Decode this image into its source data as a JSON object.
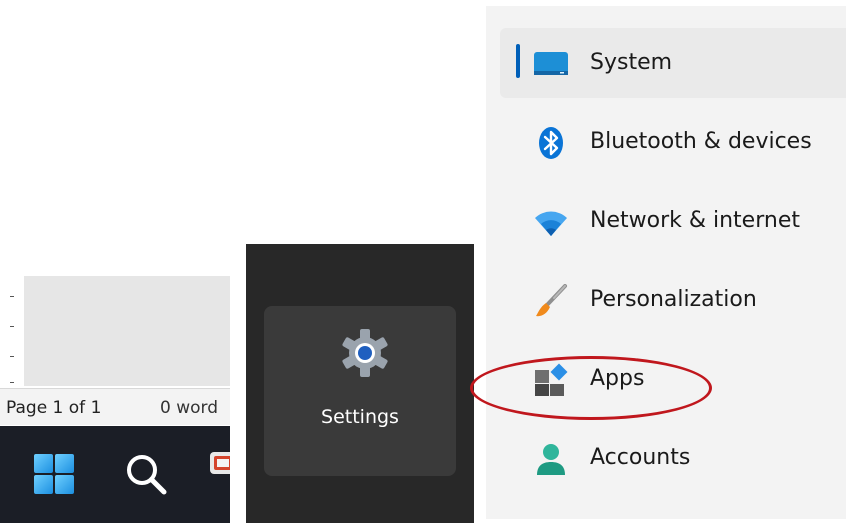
{
  "word": {
    "status_page": "Page 1 of 1",
    "status_words": "0 word"
  },
  "taskbar": {
    "icons": [
      "windows-start-icon",
      "search-icon",
      "app-icon"
    ]
  },
  "start_menu": {
    "settings_label": "Settings",
    "settings_icon": "gear-icon"
  },
  "settings_nav": {
    "items": [
      {
        "label": "System",
        "icon": "display-icon",
        "selected": true
      },
      {
        "label": "Bluetooth & devices",
        "icon": "bluetooth-icon",
        "selected": false
      },
      {
        "label": "Network & internet",
        "icon": "wifi-icon",
        "selected": false
      },
      {
        "label": "Personalization",
        "icon": "paintbrush-icon",
        "selected": false
      },
      {
        "label": "Apps",
        "icon": "apps-icon",
        "selected": false
      },
      {
        "label": "Accounts",
        "icon": "person-icon",
        "selected": false
      }
    ]
  },
  "annotation": {
    "highlighted_item": "Apps",
    "color": "#c0171d"
  },
  "colors": {
    "accent": "#005fb8",
    "taskbar_bg": "#1b1e26",
    "start_bg": "#282828",
    "tile_bg": "#3a3a3a",
    "settings_bg": "#f3f3f3"
  }
}
